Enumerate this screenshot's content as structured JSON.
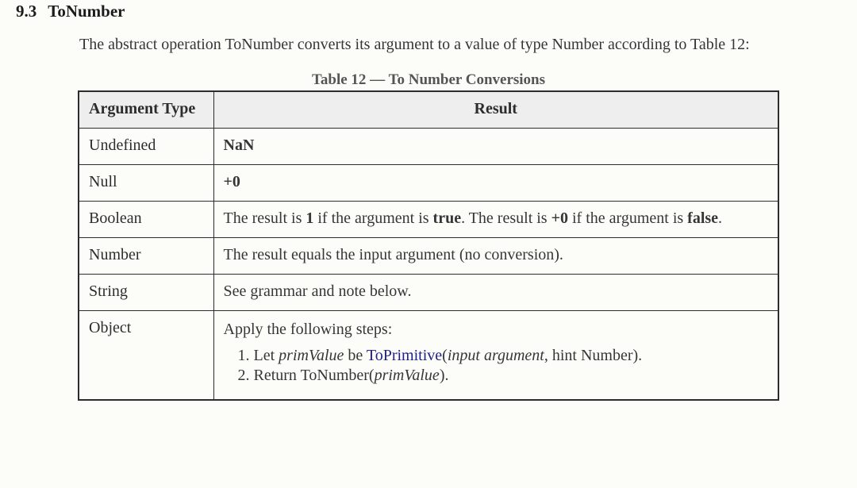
{
  "section": {
    "number": "9.3",
    "title": "ToNumber"
  },
  "intro": "The abstract operation ToNumber converts its argument to a value of type Number according to Table 12:",
  "table": {
    "caption": "Table 12 — To Number Conversions",
    "headers": {
      "arg": "Argument Type",
      "result": "Result"
    },
    "rows": {
      "undefined": {
        "type": "Undefined",
        "result": "NaN"
      },
      "null": {
        "type": "Null",
        "result": "+0"
      },
      "boolean": {
        "type": "Boolean",
        "pre1": "The result is ",
        "bold1": "1",
        "mid1": " if the argument is ",
        "true": "true",
        "mid2": ". The result is ",
        "bold2": "+0",
        "mid3": " if the argument is ",
        "false": "false",
        "post": "."
      },
      "number": {
        "type": "Number",
        "result": "The result equals the input argument (no conversion)."
      },
      "string": {
        "type": "String",
        "result": "See grammar and note below."
      },
      "object": {
        "type": "Object",
        "intro": "Apply the following steps:",
        "step1": {
          "pre": "Let ",
          "i1": "primValue",
          "mid1": " be ",
          "link": "ToPrimitive",
          "open": "(",
          "i2": "input argument",
          "post": ", hint Number)."
        },
        "step2": {
          "pre": "Return ToNumber(",
          "i1": "primValue",
          "post": ")."
        }
      }
    }
  }
}
